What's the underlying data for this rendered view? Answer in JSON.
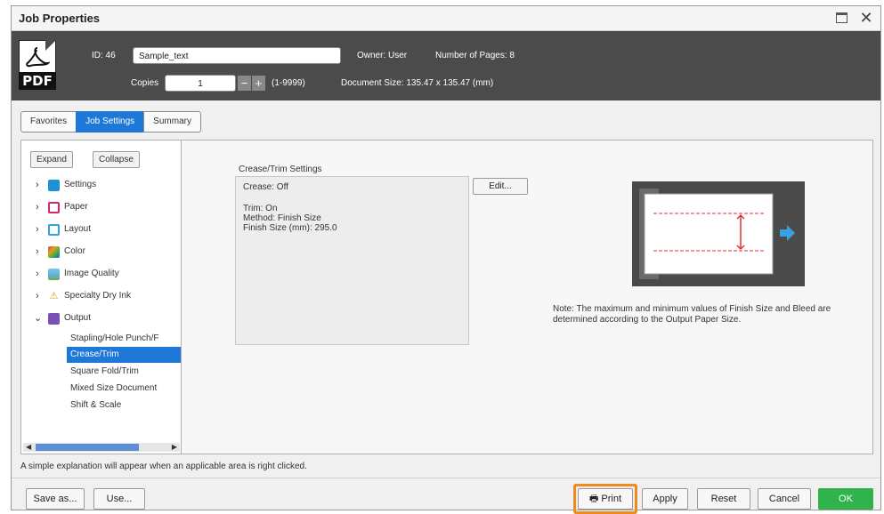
{
  "window": {
    "title": "Job Properties"
  },
  "header": {
    "id_label": "ID: 46",
    "job_name": "Sample_text",
    "owner": "Owner: User",
    "pages": "Number of Pages: 8",
    "copies_label": "Copies",
    "copies_value": "1",
    "copies_range": "(1-9999)",
    "doc_size": "Document Size: 135.47 x 135.47 (mm)",
    "icon_text": "PDF"
  },
  "tabs": [
    {
      "label": "Favorites"
    },
    {
      "label": "Job Settings"
    },
    {
      "label": "Summary"
    }
  ],
  "tree": {
    "expand_label": "Expand",
    "collapse_label": "Collapse",
    "items": [
      {
        "label": "Settings",
        "color": "#1e90d6"
      },
      {
        "label": "Paper",
        "color": "#d6246e"
      },
      {
        "label": "Layout",
        "color": "#2aa3e0"
      },
      {
        "label": "Color",
        "color": "#e0a020"
      },
      {
        "label": "Image Quality",
        "color": "#5fb0d8"
      },
      {
        "label": "Specialty Dry Ink",
        "color": "#f0c040"
      },
      {
        "label": "Output",
        "color": "#7b4fb8"
      }
    ],
    "sub_items": [
      {
        "label": "Stapling/Hole Punch/F"
      },
      {
        "label": "Crease/Trim"
      },
      {
        "label": "Square Fold/Trim"
      },
      {
        "label": "Mixed Size Document"
      },
      {
        "label": "Shift & Scale"
      }
    ]
  },
  "panel": {
    "section_title": "Crease/Trim Settings",
    "crease": "Crease: Off",
    "trim": "Trim: On",
    "method": "Method: Finish Size",
    "finish_size": "Finish Size (mm): 295.0",
    "edit_label": "Edit...",
    "note": "Note: The maximum and minimum values of Finish Size and Bleed are determined according to the Output Paper Size."
  },
  "status": {
    "text": "A simple explanation will appear when an applicable area is right clicked."
  },
  "footer": {
    "save_as": "Save as...",
    "use": "Use...",
    "print": "Print",
    "apply": "Apply",
    "reset": "Reset",
    "cancel": "Cancel",
    "ok": "OK"
  }
}
